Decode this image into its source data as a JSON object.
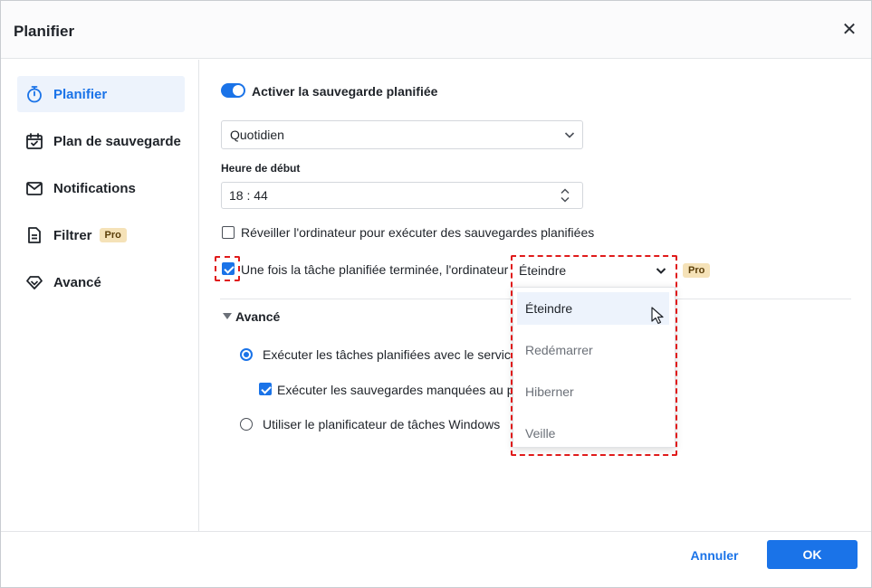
{
  "window": {
    "title": "Planifier"
  },
  "sidebar": {
    "items": [
      {
        "label": "Planifier",
        "icon": "stopwatch-icon",
        "active": true
      },
      {
        "label": "Plan de sauvegarde",
        "icon": "calendar-check-icon"
      },
      {
        "label": "Notifications",
        "icon": "envelope-icon"
      },
      {
        "label": "Filtrer",
        "icon": "document-filter-icon",
        "badge": "Pro"
      },
      {
        "label": "Avancé",
        "icon": "diamond-icon"
      }
    ]
  },
  "schedule": {
    "toggle_label": "Activer la sauvegarde planifiée",
    "toggle_on": true,
    "frequency": "Quotidien",
    "start_time_label": "Heure de début",
    "start_time": "18 : 44",
    "wake_label": "Réveiller l'ordinateur pour exécuter des sauvegardes planifiées",
    "wake_checked": false,
    "after_task_label": "Une fois la tâche planifiée terminée, l'ordinateur",
    "after_task_checked": true,
    "after_task_value": "Éteindre",
    "after_task_badge": "Pro",
    "after_task_options": [
      "Éteindre",
      "Redémarrer",
      "Hiberner",
      "Veille"
    ]
  },
  "advanced": {
    "title": "Avancé",
    "service_label": "Exécuter les tâches planifiées avec le service A",
    "missed_label": "Exécuter les sauvegardes manquées au pro",
    "windows_label": "Utiliser le planificateur de tâches Windows"
  },
  "footer": {
    "cancel": "Annuler",
    "ok": "OK"
  },
  "colors": {
    "accent": "#1a73e8",
    "highlight": "#e01b1b",
    "pro_badge": "#f5e2b8"
  }
}
